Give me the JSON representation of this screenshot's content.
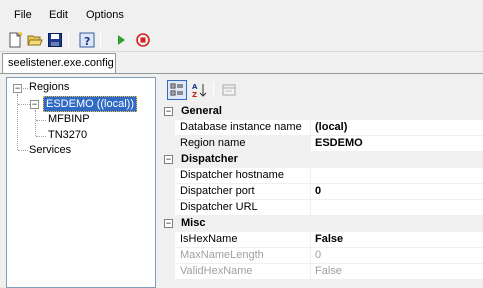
{
  "menu": {
    "file": "File",
    "edit": "Edit",
    "options": "Options"
  },
  "tab": {
    "label": "seelistener.exe.config"
  },
  "tree": {
    "root": "Regions",
    "region": "ESDEMO ((local))",
    "children": [
      "MFBINP",
      "TN3270"
    ],
    "services": "Services"
  },
  "propgrid": {
    "general": {
      "label": "General",
      "rows": [
        {
          "name": "Database instance name",
          "value": "(local)"
        },
        {
          "name": "Region name",
          "value": "ESDEMO"
        }
      ]
    },
    "dispatcher": {
      "label": "Dispatcher",
      "rows": [
        {
          "name": "Dispatcher hostname",
          "value": ""
        },
        {
          "name": "Dispatcher port",
          "value": "0"
        },
        {
          "name": "Dispatcher URL",
          "value": ""
        }
      ]
    },
    "misc": {
      "label": "Misc",
      "rows": [
        {
          "name": "IsHexName",
          "value": "False"
        },
        {
          "name": "MaxNameLength",
          "value": "0"
        },
        {
          "name": "ValidHexName",
          "value": "False"
        }
      ]
    }
  },
  "colors": {
    "selection": "#316ac5",
    "border": "#7f9db9",
    "disabled_text": "#a0a0a0"
  }
}
